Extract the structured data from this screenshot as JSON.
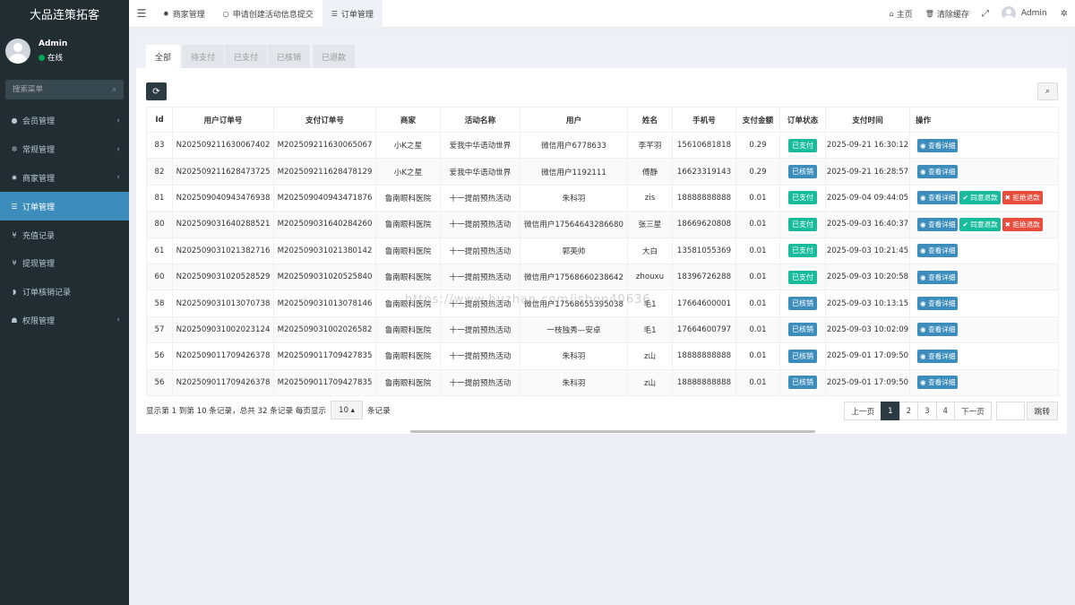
{
  "app": {
    "title": "大品连策拓客"
  },
  "user": {
    "name": "Admin",
    "status": "在线"
  },
  "sidebar": {
    "search_placeholder": "搜索菜单",
    "items": [
      {
        "label": "会员管理",
        "icon": "user-icon",
        "glyph": "●",
        "arrow": "‹"
      },
      {
        "label": "常规管理",
        "icon": "gears-icon",
        "glyph": "✲",
        "arrow": "‹"
      },
      {
        "label": "商家管理",
        "icon": "gear-icon",
        "glyph": "✹",
        "arrow": "‹"
      },
      {
        "label": "订单管理",
        "icon": "list-icon",
        "glyph": "☰",
        "arrow": ""
      },
      {
        "label": "充值记录",
        "icon": "yen-icon",
        "glyph": "¥",
        "arrow": ""
      },
      {
        "label": "提现管理",
        "icon": "yen-icon",
        "glyph": "¥",
        "arrow": ""
      },
      {
        "label": "订单核销记录",
        "icon": "shield-icon",
        "glyph": "◗",
        "arrow": ""
      },
      {
        "label": "权限管理",
        "icon": "group-icon",
        "glyph": "☗",
        "arrow": "‹"
      }
    ]
  },
  "topbar": {
    "tabs": [
      {
        "label": "商家管理",
        "glyph": "✹"
      },
      {
        "label": "申请创建活动信息提交",
        "glyph": "○"
      },
      {
        "label": "订单管理",
        "glyph": "☰"
      }
    ],
    "home": "主页",
    "clear_cache": "清除缓存",
    "user": "Admin"
  },
  "filters": [
    "全部",
    "待支付",
    "已支付",
    "已核销",
    "已退款"
  ],
  "table": {
    "headers": [
      "Id",
      "用户订单号",
      "支付订单号",
      "商家",
      "活动名称",
      "用户",
      "姓名",
      "手机号",
      "支付金额",
      "订单状态",
      "支付时间",
      "操作"
    ],
    "rows": [
      [
        "83",
        "N202509211630067402",
        "M202509211630065067",
        "小K之星",
        "爱我中华语动世界",
        "微信用户6778633",
        "李芊羽",
        "15610681818",
        "0.29",
        "已支付",
        "2025-09-21 16:30:12"
      ],
      [
        "82",
        "N202509211628473725",
        "M202509211628478129",
        "小K之星",
        "爱我中华语动世界",
        "微信用户1192111",
        "傅静",
        "16623319143",
        "0.29",
        "已核销",
        "2025-09-21 16:28:57"
      ],
      [
        "81",
        "N202509040943476938",
        "M202509040943471876",
        "鲁南眼科医院",
        "十一提前预热活动",
        "朱科羽",
        "zis",
        "18888888888",
        "0.01",
        "已支付",
        "2025-09-04 09:44:05"
      ],
      [
        "80",
        "N202509031640288521",
        "M202509031640284260",
        "鲁南眼科医院",
        "十一提前预热活动",
        "微信用户17564643286680",
        "张三星",
        "18669620808",
        "0.01",
        "已支付",
        "2025-09-03 16:40:37"
      ],
      [
        "61",
        "N202509031021382716",
        "M202509031021380142",
        "鲁南眼科医院",
        "十一提前预热活动",
        "郭英帅",
        "大白",
        "13581055369",
        "0.01",
        "已支付",
        "2025-09-03 10:21:45"
      ],
      [
        "60",
        "N202509031020528529",
        "M202509031020525840",
        "鲁南眼科医院",
        "十一提前预热活动",
        "微信用户17568660238642",
        "zhouxu",
        "18396726288",
        "0.01",
        "已支付",
        "2025-09-03 10:20:58"
      ],
      [
        "58",
        "N202509031013070738",
        "M202509031013078146",
        "鲁南眼科医院",
        "十一提前预热活动",
        "微信用户17568655395038",
        "毛1",
        "17664600001",
        "0.01",
        "已核销",
        "2025-09-03 10:13:15"
      ],
      [
        "57",
        "N202509031002023124",
        "M202509031002026582",
        "鲁南眼科医院",
        "十一提前预热活动",
        "一枝独秀—安卓",
        "毛1",
        "17664600797",
        "0.01",
        "已核销",
        "2025-09-03 10:02:09"
      ],
      [
        "56",
        "N202509011709426378",
        "M202509011709427835",
        "鲁南眼科医院",
        "十一提前预热活动",
        "朱科羽",
        "z山",
        "18888888888",
        "0.01",
        "已核销",
        "2025-09-01 17:09:50"
      ],
      [
        "56",
        "N202509011709426378",
        "M202509011709427835",
        "鲁南眼科医院",
        "十一提前预热活动",
        "朱科羽",
        "z山",
        "18888888888",
        "0.01",
        "已核销",
        "2025-09-01 17:09:50"
      ]
    ],
    "row_actions": [
      [
        "view"
      ],
      [
        "view"
      ],
      [
        "view",
        "agree",
        "reject"
      ],
      [
        "view",
        "agree",
        "reject"
      ],
      [
        "view"
      ],
      [
        "view"
      ],
      [
        "view"
      ],
      [
        "view"
      ],
      [
        "view"
      ],
      [
        "view"
      ]
    ],
    "action_labels": {
      "view": "查看详细",
      "agree": "同意退款",
      "reject": "拒绝退款"
    }
  },
  "footer": {
    "summary": "显示第 1 到第 10 条记录，总共 32 条记录 每页显示",
    "page_size": "10",
    "suffix": "条记录",
    "prev": "上一页",
    "next": "下一页",
    "pages": [
      "1",
      "2",
      "3",
      "4"
    ],
    "jump": "跳转"
  },
  "watermark": "https://www.huzhan.com/ishop40636",
  "colors": {
    "sidebar": "#222d32",
    "accent": "#3c8dbc",
    "paid": "#18bc9c",
    "reject": "#e74c3c"
  }
}
